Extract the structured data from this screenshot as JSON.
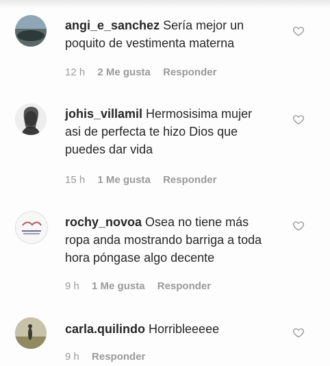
{
  "comments": [
    {
      "username": "angi_e_sanchez",
      "text": "Sería mejor un poquito de vestimenta materna",
      "time": "12 h",
      "likes": "2 Me gusta",
      "reply": "Responder",
      "like_icon": "heart-outline-icon"
    },
    {
      "username": "johis_villamil",
      "text": "Hermosisima mujer asi de perfecta te hizo Dios que puedes dar vida",
      "time": "15 h",
      "likes": "1 Me gusta",
      "reply": "Responder",
      "like_icon": "heart-outline-icon"
    },
    {
      "username": "rochy_novoa",
      "text": "Osea no tiene más ropa anda mostrando barriga a toda hora póngase algo decente",
      "time": "9 h",
      "likes": "1 Me gusta",
      "reply": "Responder",
      "like_icon": "heart-outline-icon"
    },
    {
      "username": "carla.quilindo",
      "text": "Horribleeeee",
      "time": "9 h",
      "reply": "Responder",
      "like_icon": "heart-outline-icon"
    }
  ],
  "colors": {
    "text": "#262626",
    "meta": "#9a9a9a",
    "background": "#fdfdfd"
  }
}
